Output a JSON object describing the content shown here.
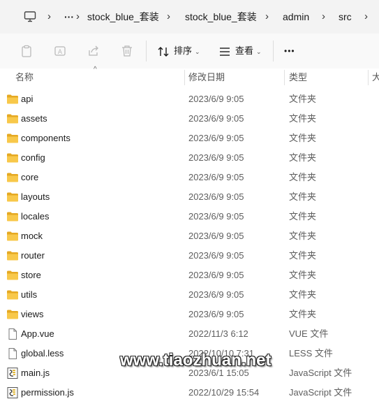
{
  "breadcrumb": {
    "more": "···",
    "items": [
      "stock_blue_套装",
      "stock_blue_套装",
      "admin",
      "src"
    ]
  },
  "toolbar": {
    "sort_label": "排序",
    "view_label": "查看",
    "more_label": "•••"
  },
  "columns": {
    "name": "名称",
    "date": "修改日期",
    "type": "类型",
    "size": "大"
  },
  "files": [
    {
      "name": "api",
      "date": "2023/6/9 9:05",
      "type": "文件夹",
      "kind": "folder"
    },
    {
      "name": "assets",
      "date": "2023/6/9 9:05",
      "type": "文件夹",
      "kind": "folder"
    },
    {
      "name": "components",
      "date": "2023/6/9 9:05",
      "type": "文件夹",
      "kind": "folder"
    },
    {
      "name": "config",
      "date": "2023/6/9 9:05",
      "type": "文件夹",
      "kind": "folder"
    },
    {
      "name": "core",
      "date": "2023/6/9 9:05",
      "type": "文件夹",
      "kind": "folder"
    },
    {
      "name": "layouts",
      "date": "2023/6/9 9:05",
      "type": "文件夹",
      "kind": "folder"
    },
    {
      "name": "locales",
      "date": "2023/6/9 9:05",
      "type": "文件夹",
      "kind": "folder"
    },
    {
      "name": "mock",
      "date": "2023/6/9 9:05",
      "type": "文件夹",
      "kind": "folder"
    },
    {
      "name": "router",
      "date": "2023/6/9 9:05",
      "type": "文件夹",
      "kind": "folder"
    },
    {
      "name": "store",
      "date": "2023/6/9 9:05",
      "type": "文件夹",
      "kind": "folder"
    },
    {
      "name": "utils",
      "date": "2023/6/9 9:05",
      "type": "文件夹",
      "kind": "folder"
    },
    {
      "name": "views",
      "date": "2023/6/9 9:05",
      "type": "文件夹",
      "kind": "folder"
    },
    {
      "name": "App.vue",
      "date": "2022/11/3 6:12",
      "type": "VUE 文件",
      "kind": "file"
    },
    {
      "name": "global.less",
      "date": "2022/10/10 7:31",
      "type": "LESS 文件",
      "kind": "file"
    },
    {
      "name": "main.js",
      "date": "2023/6/1 15:05",
      "type": "JavaScript 文件",
      "kind": "script"
    },
    {
      "name": "permission.js",
      "date": "2022/10/29 15:54",
      "type": "JavaScript 文件",
      "kind": "script"
    }
  ],
  "watermark": "www.tiaozhuan.net",
  "colors": {
    "folder": "#f8c84a",
    "folder_dark": "#e5a923",
    "accent": "#0067c0"
  }
}
